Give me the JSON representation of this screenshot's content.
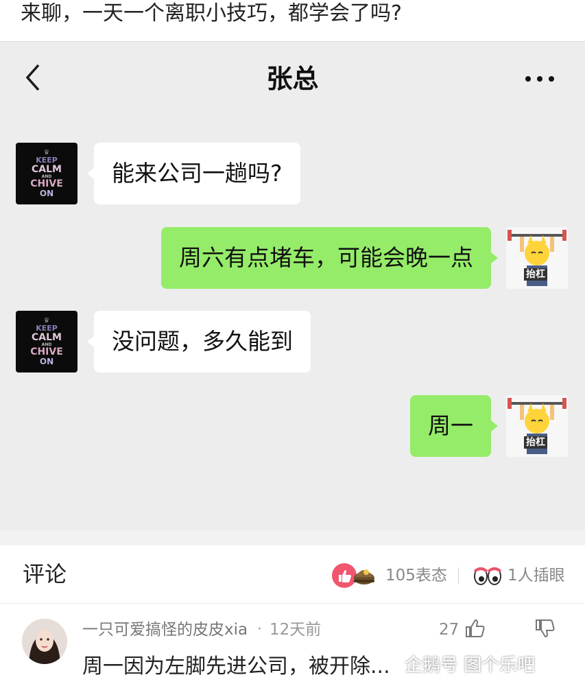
{
  "post": {
    "title": "来聊，一天一个离职小技巧，都学会了吗?"
  },
  "chat": {
    "contact_name": "张总",
    "back_icon": "chevron-left-icon",
    "more_icon": "more-dots-icon",
    "partner_avatar": {
      "lines": [
        "KEEP",
        "CALM",
        "AND",
        "CHIVE",
        "ON"
      ]
    },
    "my_avatar": {
      "badge": "抬杠"
    },
    "messages": [
      {
        "from": "them",
        "text": "能来公司一趟吗?"
      },
      {
        "from": "me",
        "text": "周六有点堵车，可能会晚一点"
      },
      {
        "from": "them",
        "text": "没问题，多久能到"
      },
      {
        "from": "me",
        "text": "周一"
      }
    ],
    "colors": {
      "incoming": "#ffffff",
      "outgoing": "#95ec69",
      "background": "#ededed"
    }
  },
  "comments": {
    "title": "评论",
    "reactions_label": "105表态",
    "interjections_label": "1人插眼",
    "items": [
      {
        "author": "一只可爱搞怪的皮皮xia",
        "time": "12天前",
        "likes": "27",
        "text": "周一因为左脚先进公司，被开除..."
      }
    ]
  },
  "watermark": "企鹅号 图个乐吧"
}
